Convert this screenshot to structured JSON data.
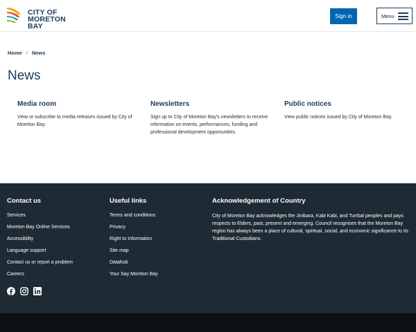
{
  "header": {
    "logo_line1": "CITY OF",
    "logo_line2": "MORETON BAY",
    "signin_label": "Sign in",
    "menu_label": "Menu"
  },
  "breadcrumb": {
    "home": "Home",
    "separator": "/",
    "current": "News"
  },
  "page_title": "News",
  "cards": [
    {
      "title": "Media room",
      "description": "View or subscribe to media releases issued by City of Moreton Bay."
    },
    {
      "title": "Newsletters",
      "description": "Sign up to City of Moreton Bay's newsletters to receive information on events, performances, funding and professional development opportunities."
    },
    {
      "title": "Public notices",
      "description": "View public notices issued by City of Moreton Bay."
    }
  ],
  "footer": {
    "contact": {
      "heading": "Contact us",
      "items": [
        "Services",
        "Moreton Bay Online Services",
        "Accessibility",
        "Language support",
        "Contact us or report a problem",
        "Careers"
      ]
    },
    "useful": {
      "heading": "Useful links",
      "items": [
        "Terms and conditions",
        "Privacy",
        "Right to Information",
        "Site map",
        "Datahub",
        "Your Say Moreton Bay"
      ]
    },
    "acknowledgement": {
      "heading": "Acknowledgement of Country",
      "text": "City of Moreton Bay acknowledges the Jinibara, Kabi Kabi, and Turrbal peoples and pays respects to Elders, past, present and emerging. Council recognises that the Moreton Bay region has always been a place of cultural, spiritual, social, and economic significance to its Traditional Custodians."
    },
    "socials": [
      "facebook-icon",
      "instagram-icon",
      "linkedin-icon"
    ]
  },
  "colors": {
    "brand_navy": "#1d3a5a",
    "button_blue": "#0066b3",
    "footer_bg": "#1e2b35",
    "bottom_bar": "#0d1114"
  }
}
